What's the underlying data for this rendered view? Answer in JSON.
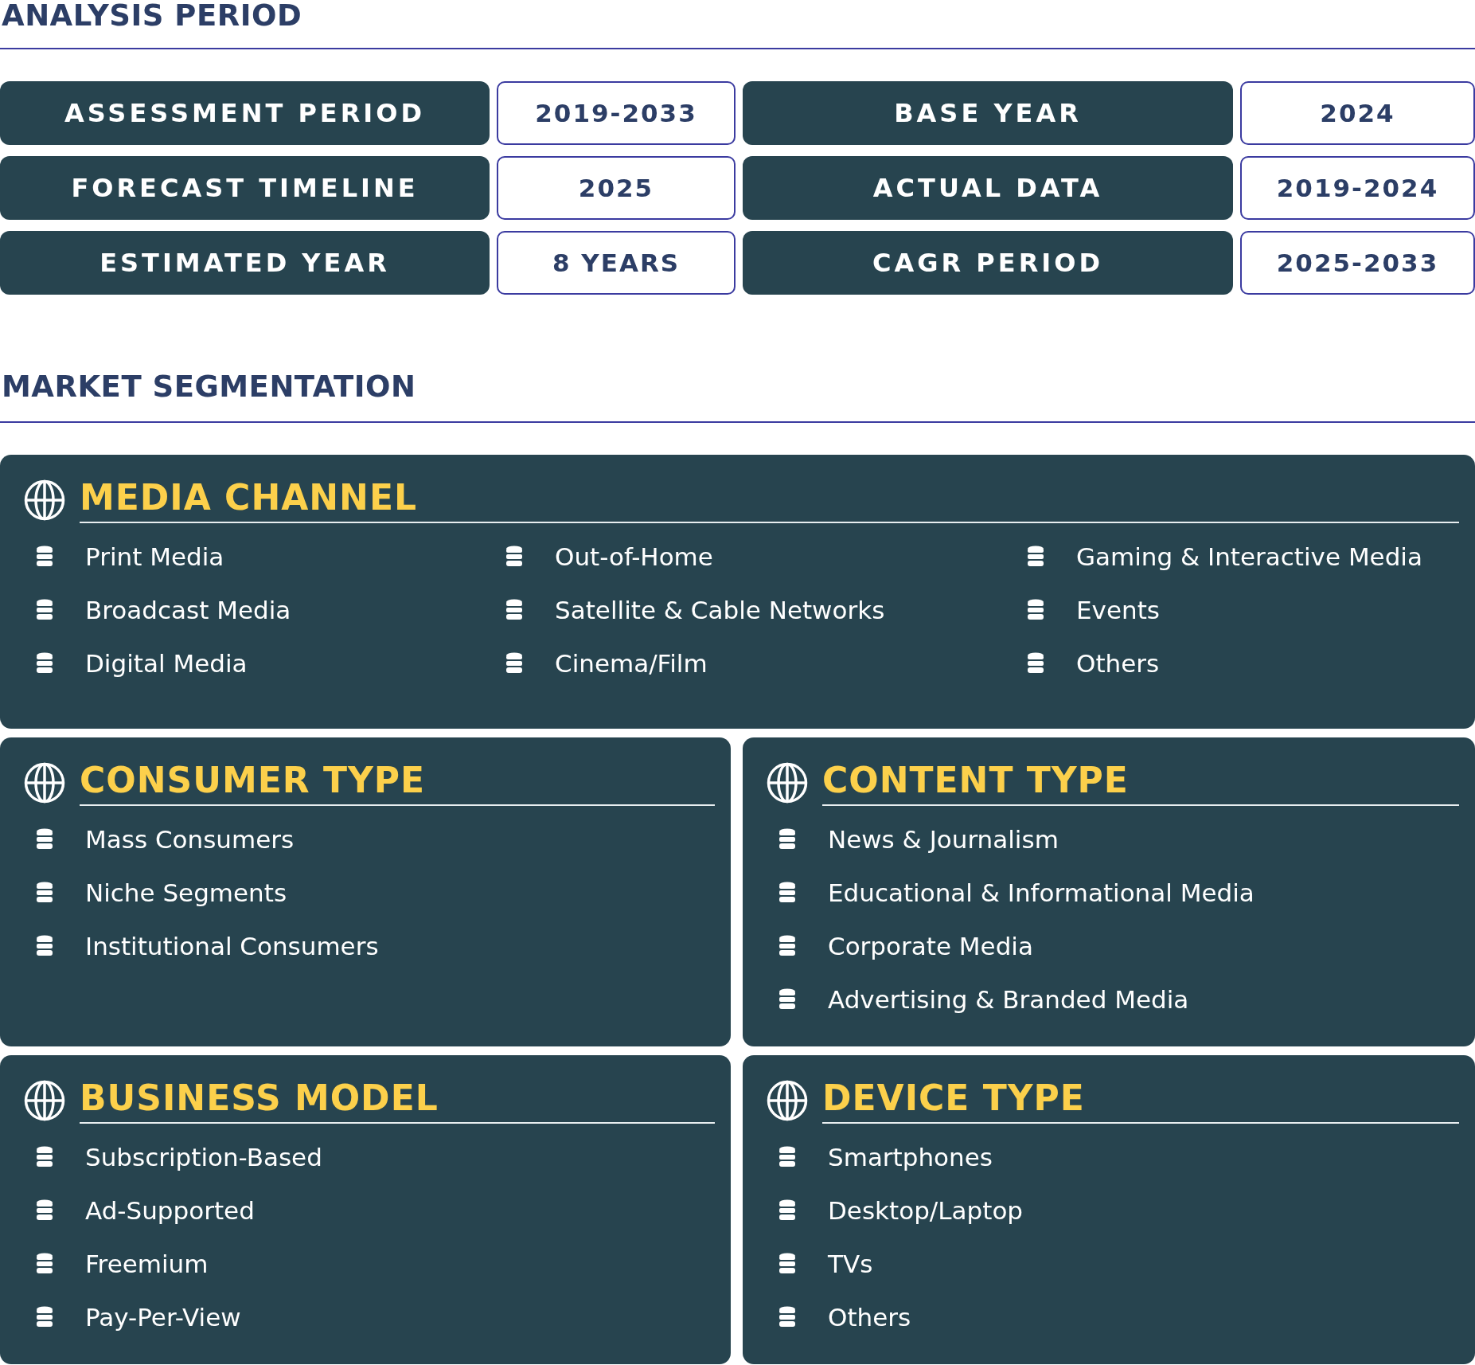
{
  "analysis_period": {
    "heading": "ANALYSIS PERIOD",
    "rows": [
      {
        "label": "ASSESSMENT PERIOD",
        "value": "2019-2033"
      },
      {
        "label": "BASE YEAR",
        "value": "2024"
      },
      {
        "label": "FORECAST TIMELINE",
        "value": "2025"
      },
      {
        "label": "ACTUAL DATA",
        "value": "2019-2024"
      },
      {
        "label": "ESTIMATED YEAR",
        "value": "8 YEARS"
      },
      {
        "label": "CAGR PERIOD",
        "value": "2025-2033"
      }
    ]
  },
  "market_segmentation": {
    "heading": "MARKET SEGMENTATION",
    "segments": [
      {
        "kind": "wide",
        "title": "MEDIA CHANNEL",
        "items": [
          "Print Media",
          "Broadcast Media",
          "Digital Media",
          "Out-of-Home",
          "Satellite & Cable Networks",
          "Cinema/Film",
          "Gaming & Interactive Media",
          "Events",
          "Others"
        ]
      },
      {
        "kind": "half",
        "title": "CONSUMER TYPE",
        "items": [
          "Mass Consumers",
          "Niche Segments",
          "Institutional Consumers"
        ]
      },
      {
        "kind": "half",
        "title": "CONTENT TYPE",
        "items": [
          "News & Journalism",
          "Educational & Informational Media",
          "Corporate Media",
          "Advertising & Branded Media"
        ]
      },
      {
        "kind": "half",
        "title": "BUSINESS MODEL",
        "items": [
          "Subscription-Based",
          "Ad-Supported",
          "Freemium",
          "Pay-Per-View"
        ]
      },
      {
        "kind": "half",
        "title": "DEVICE TYPE",
        "items": [
          "Smartphones",
          "Desktop/Laptop",
          "TVs",
          "Others"
        ]
      }
    ]
  }
}
